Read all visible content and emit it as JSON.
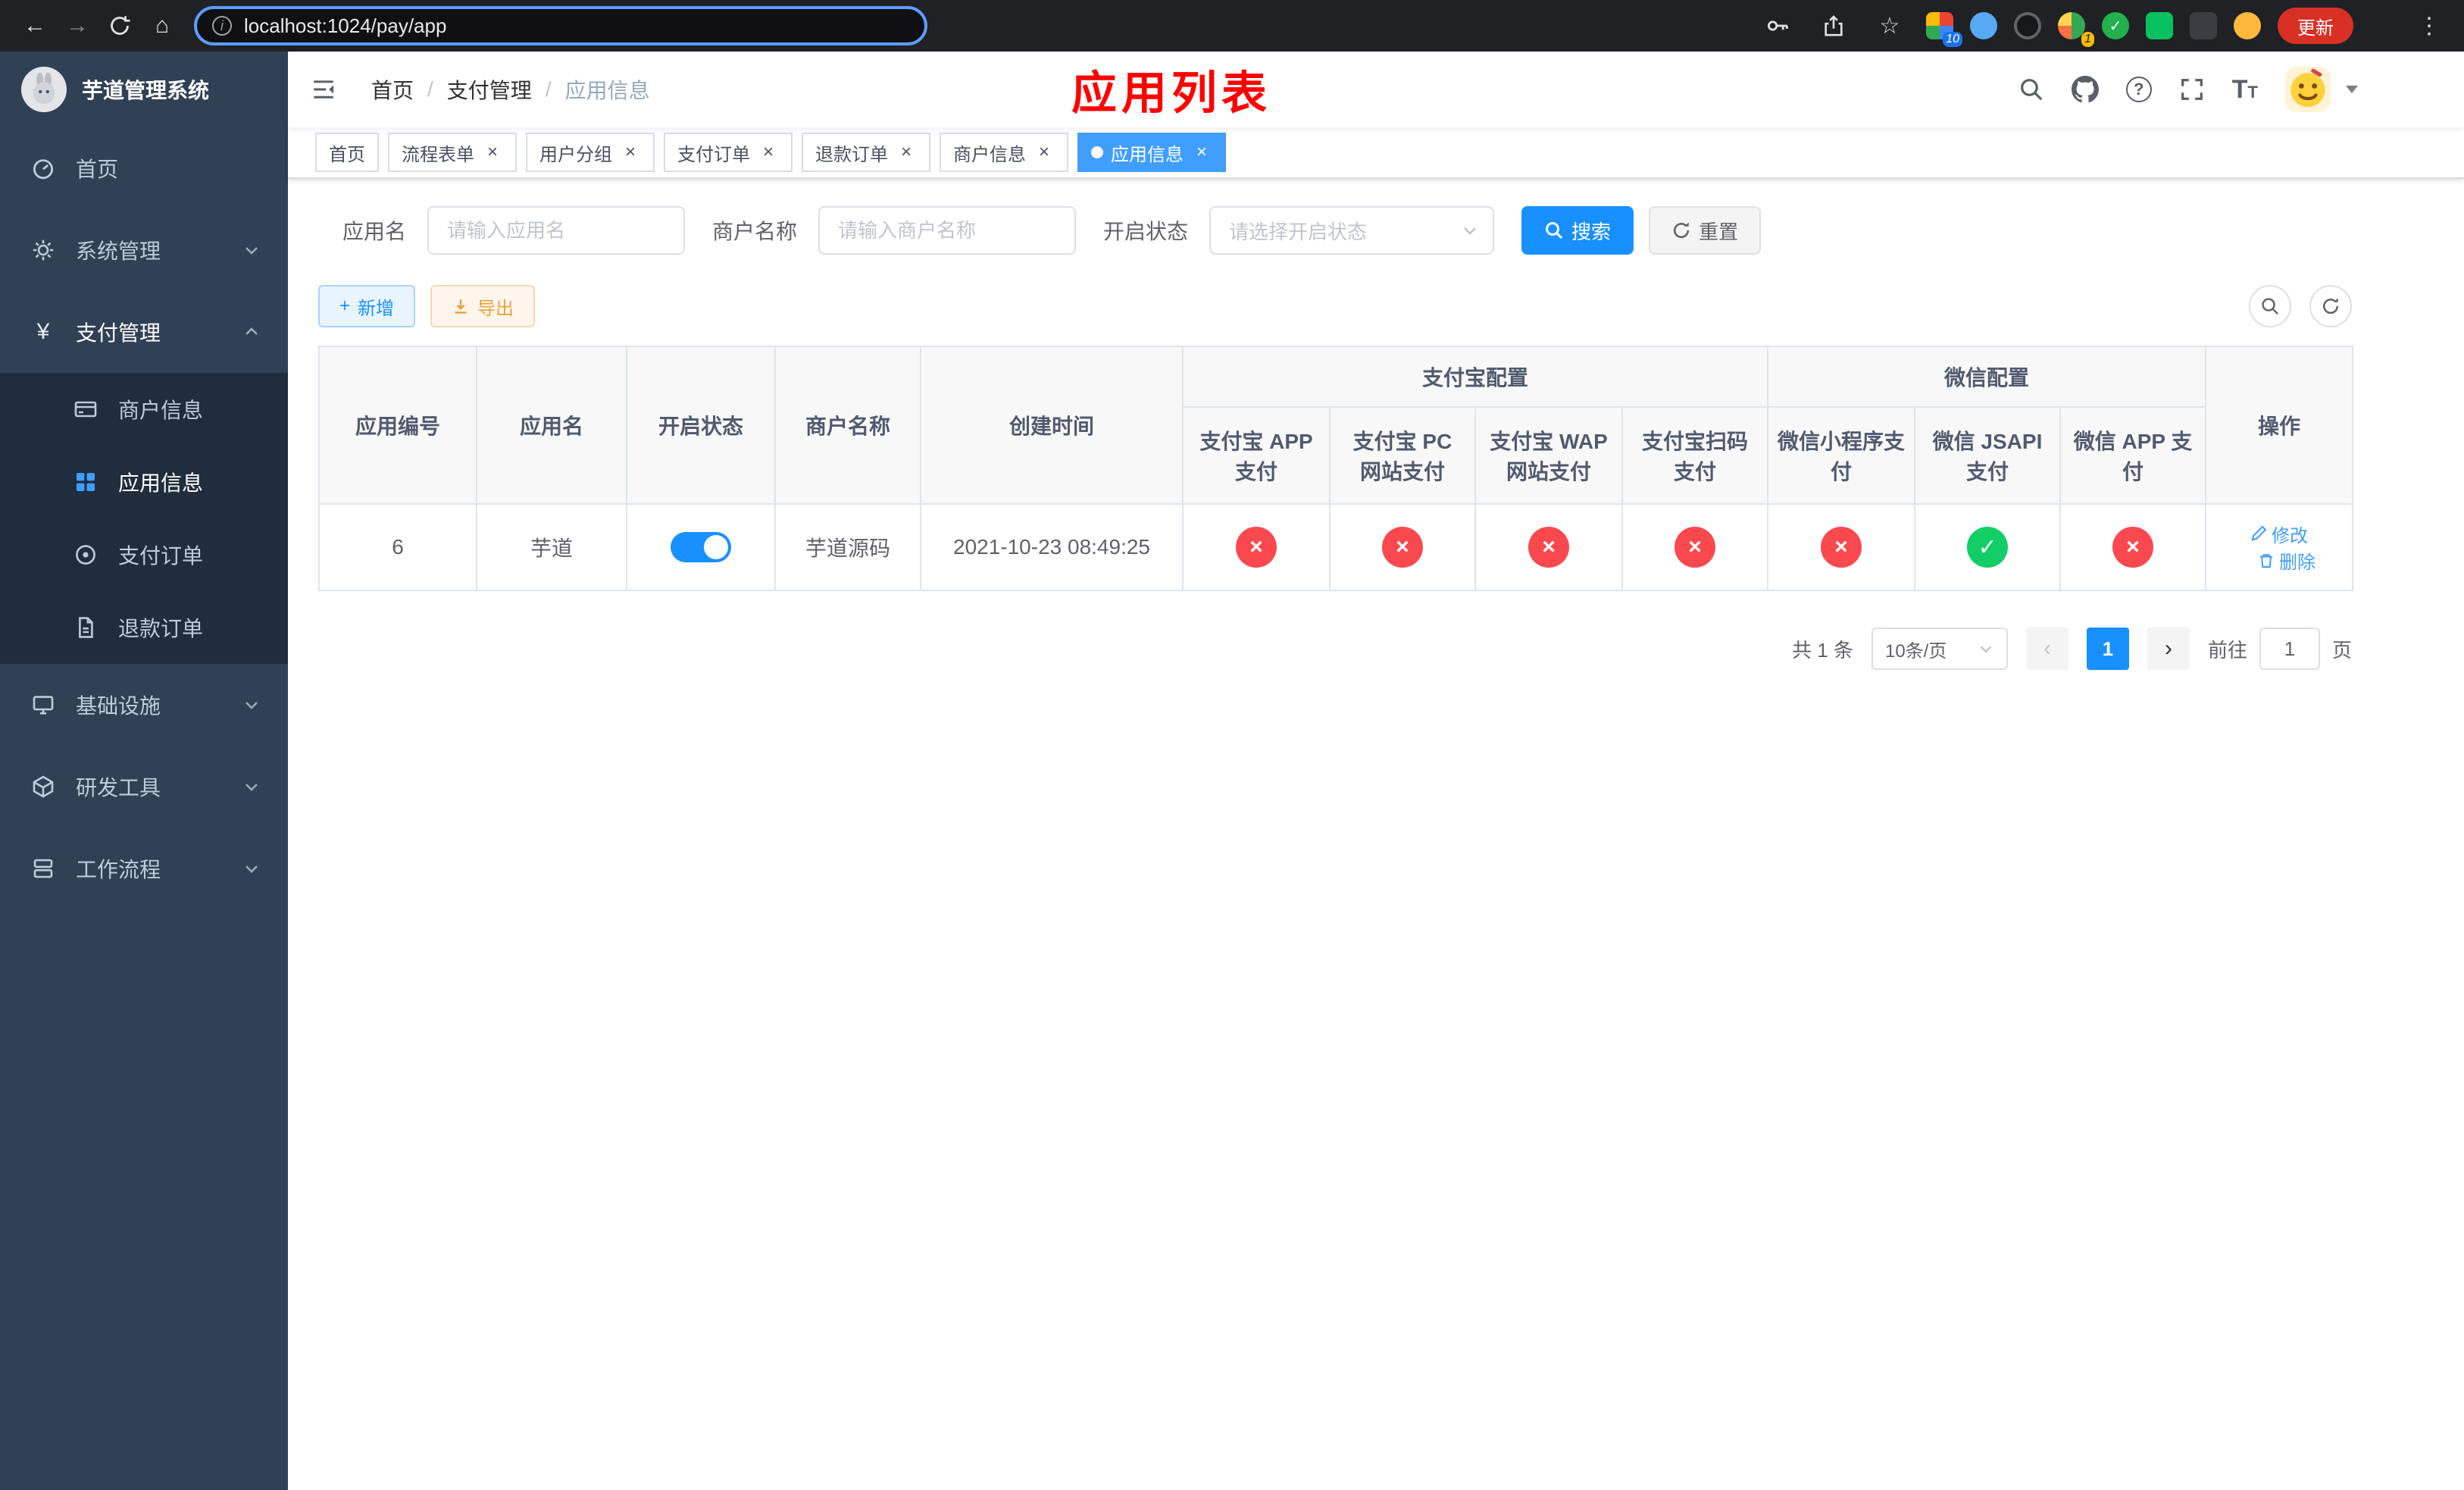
{
  "browser": {
    "url": "localhost:1024/pay/app",
    "update_label": "更新",
    "extension_badges": {
      "first": "10",
      "second": "1"
    }
  },
  "icons": {
    "back": "←",
    "forward": "→",
    "home": "⌂",
    "star": "☆",
    "dots": "⋮",
    "info": "i",
    "question": "?",
    "close": "×",
    "check": "✓",
    "cross": "×",
    "plus": "+",
    "prev": "‹",
    "next": "›",
    "yen": "¥",
    "font_large": "T",
    "font_small": "T"
  },
  "sidebar": {
    "title": "芋道管理系统",
    "menu": [
      {
        "label": "首页"
      },
      {
        "label": "系统管理"
      },
      {
        "label": "支付管理"
      },
      {
        "label": "基础设施"
      },
      {
        "label": "研发工具"
      },
      {
        "label": "工作流程"
      }
    ],
    "payment_submenu": [
      {
        "label": "商户信息"
      },
      {
        "label": "应用信息",
        "active": true
      },
      {
        "label": "支付订单"
      },
      {
        "label": "退款订单"
      }
    ]
  },
  "header": {
    "breadcrumb": [
      "首页",
      "支付管理",
      "应用信息"
    ],
    "breadcrumb_separator": "/",
    "page_overlay_title": "应用列表"
  },
  "tabs": [
    {
      "label": "首页",
      "closable": false,
      "active": false
    },
    {
      "label": "流程表单",
      "closable": true,
      "active": false
    },
    {
      "label": "用户分组",
      "closable": true,
      "active": false
    },
    {
      "label": "支付订单",
      "closable": true,
      "active": false
    },
    {
      "label": "退款订单",
      "closable": true,
      "active": false
    },
    {
      "label": "商户信息",
      "closable": true,
      "active": false
    },
    {
      "label": "应用信息",
      "closable": true,
      "active": true
    }
  ],
  "filters": {
    "app_name_label": "应用名",
    "app_name_placeholder": "请输入应用名",
    "merchant_label": "商户名称",
    "merchant_placeholder": "请输入商户名称",
    "status_label": "开启状态",
    "status_placeholder": "请选择开启状态",
    "search_label": "搜索",
    "reset_label": "重置"
  },
  "toolbar": {
    "add_label": "新增",
    "export_label": "导出"
  },
  "table": {
    "headers": {
      "app_id": "应用编号",
      "app_name": "应用名",
      "status": "开启状态",
      "merchant": "商户名称",
      "created": "创建时间",
      "alipay_group": "支付宝配置",
      "wechat_group": "微信配置",
      "actions": "操作",
      "alipay_cols": [
        "支付宝 APP 支付",
        "支付宝 PC 网站支付",
        "支付宝 WAP 网站支付",
        "支付宝扫码支付"
      ],
      "wechat_cols": [
        "微信小程序支付",
        "微信 JSAPI 支付",
        "微信 APP 支付"
      ]
    },
    "row": {
      "app_id": "6",
      "app_name": "芋道",
      "status_on": true,
      "merchant": "芋道源码",
      "created": "2021-10-23 08:49:25",
      "pay_status": [
        "no",
        "no",
        "no",
        "no",
        "no",
        "yes",
        "no"
      ],
      "edit_label": "修改",
      "delete_label": "删除"
    }
  },
  "pagination": {
    "total_label": "共 1 条",
    "page_size_label": "10条/页",
    "current_page": "1",
    "goto_prefix": "前往",
    "goto_value": "1",
    "goto_suffix": "页"
  },
  "colors": {
    "primary": "#1890ff",
    "menu_active": "#409eff",
    "status_no": "#f9494f",
    "status_yes": "#13ce66",
    "update_chip": "#d93025",
    "overlay_title": "#ff0000",
    "sidebar_bg": "#304156",
    "submenu_bg": "#1f2d3d"
  }
}
